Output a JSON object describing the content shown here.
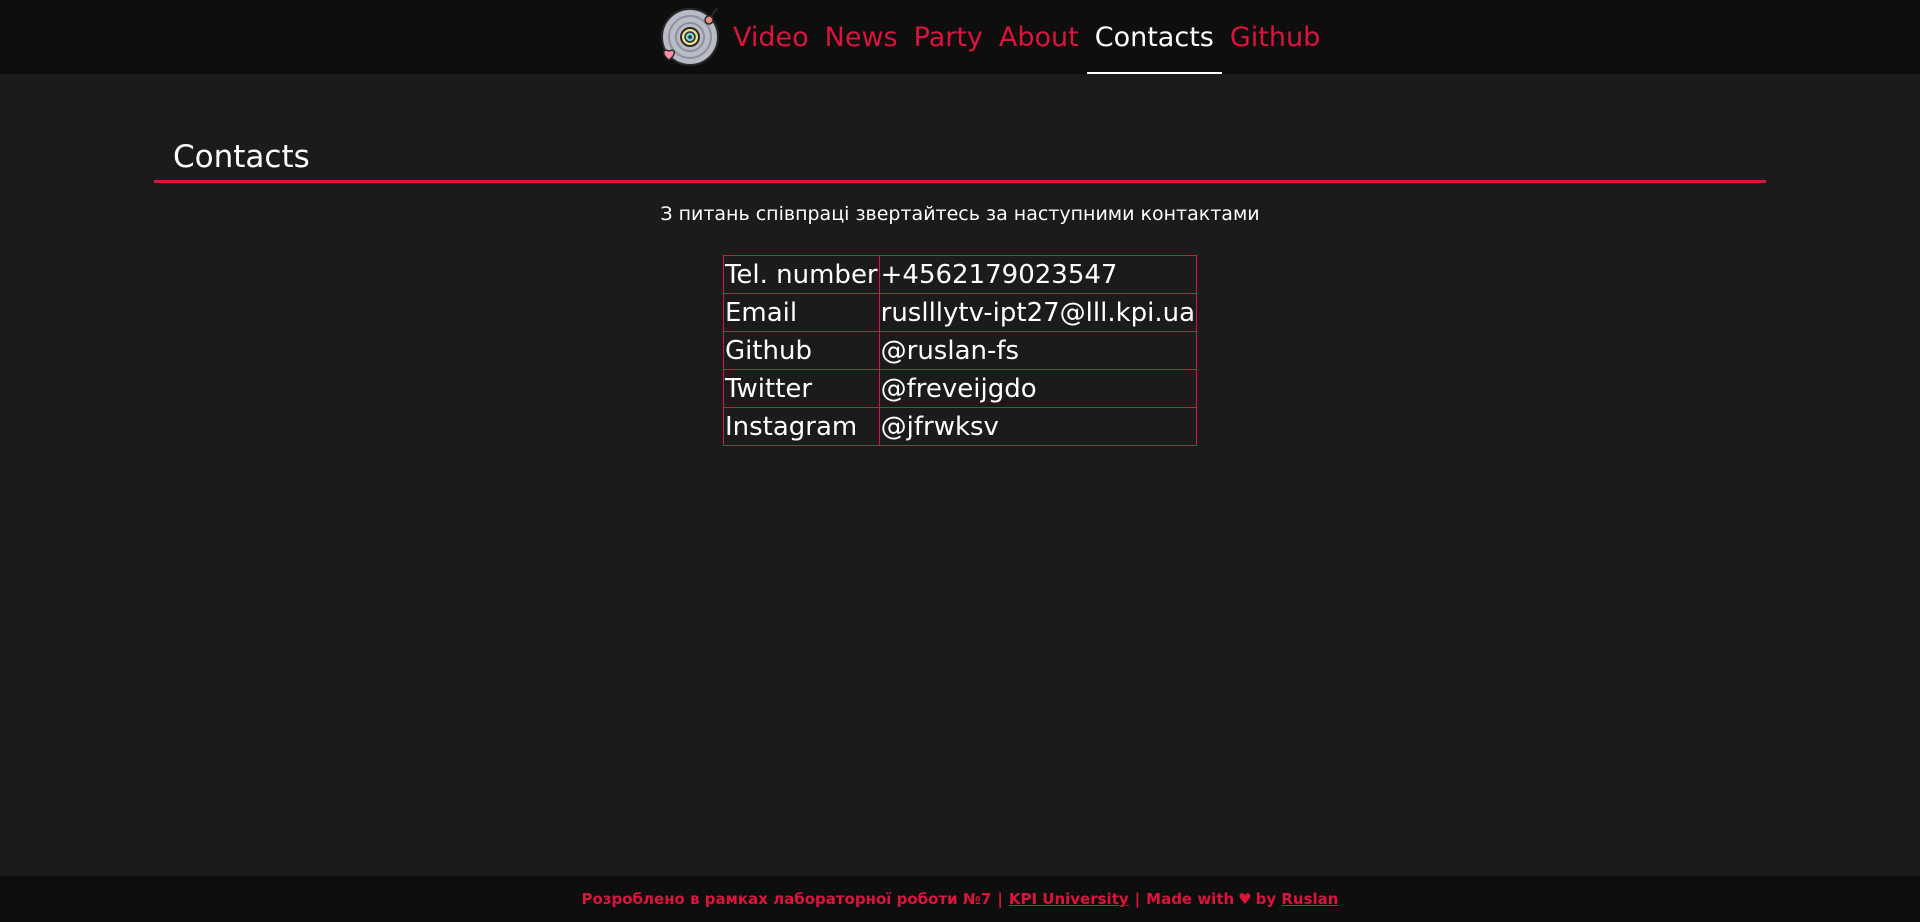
{
  "nav": {
    "items": [
      {
        "label": "Video",
        "active": false
      },
      {
        "label": "News",
        "active": false
      },
      {
        "label": "Party",
        "active": false
      },
      {
        "label": "About",
        "active": false
      },
      {
        "label": "Contacts",
        "active": true
      },
      {
        "label": "Github",
        "active": false
      }
    ]
  },
  "main": {
    "title": "Contacts",
    "subtitle": "З питань співпраці звертайтесь за наступними контактами",
    "contacts": [
      {
        "key": "Tel. number",
        "value": "+4562179023547"
      },
      {
        "key": "Email",
        "value": "ruslllytv-ipt27@lll.kpi.ua"
      },
      {
        "key": "Github",
        "value": "@ruslan-fs"
      },
      {
        "key": "Twitter",
        "value": "@freveijgdo"
      },
      {
        "key": "Instagram",
        "value": "@jfrwksv"
      }
    ]
  },
  "footer": {
    "text_before": "Розроблено в рамках лабораторної роботи №7",
    "link1": "KPI University",
    "made_with": "Made with",
    "heart": "♥",
    "by": "by",
    "link2": "Ruslan"
  },
  "colors": {
    "accent": "#dc143c",
    "background": "#1b1b1b",
    "bar": "#0e0e0e"
  }
}
